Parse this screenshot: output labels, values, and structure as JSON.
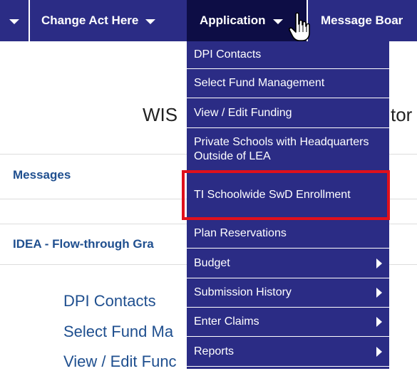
{
  "navbar": {
    "items": [
      {
        "label": ""
      },
      {
        "label": "Change Act Here"
      },
      {
        "label": "Application"
      },
      {
        "label": "Message Boar"
      }
    ]
  },
  "page": {
    "heading_left": "WIS",
    "heading_right": "tor",
    "sections": [
      {
        "title": "Messages"
      },
      {
        "title": "IDEA - Flow-through Gra"
      }
    ],
    "links": [
      "DPI Contacts",
      "Select Fund Ma",
      "View / Edit Func"
    ]
  },
  "menu": {
    "items": [
      {
        "label": "DPI Contacts",
        "has_submenu": false
      },
      {
        "label": "Select Fund Management",
        "has_submenu": false
      },
      {
        "label": "View / Edit Funding",
        "has_submenu": false
      },
      {
        "label": "Private Schools with Headquarters Outside of LEA",
        "has_submenu": false
      },
      {
        "label": "TI Schoolwide SwD Enrollment",
        "has_submenu": false,
        "highlighted": true
      },
      {
        "label": "Plan Reservations",
        "has_submenu": false
      },
      {
        "label": "Budget",
        "has_submenu": true
      },
      {
        "label": "Submission History",
        "has_submenu": true
      },
      {
        "label": "Enter Claims",
        "has_submenu": true
      },
      {
        "label": "Reports",
        "has_submenu": true
      }
    ]
  },
  "colors": {
    "nav_bg": "#2b2c85",
    "nav_active_bg": "#0d0d45",
    "menu_bg": "#2b2c85",
    "link_color": "#1f4f8f",
    "highlight_border": "#e0101c"
  },
  "icons": {
    "cursor": "hand-pointer-icon",
    "dropdown": "caret-down-icon",
    "submenu": "caret-right-icon"
  }
}
